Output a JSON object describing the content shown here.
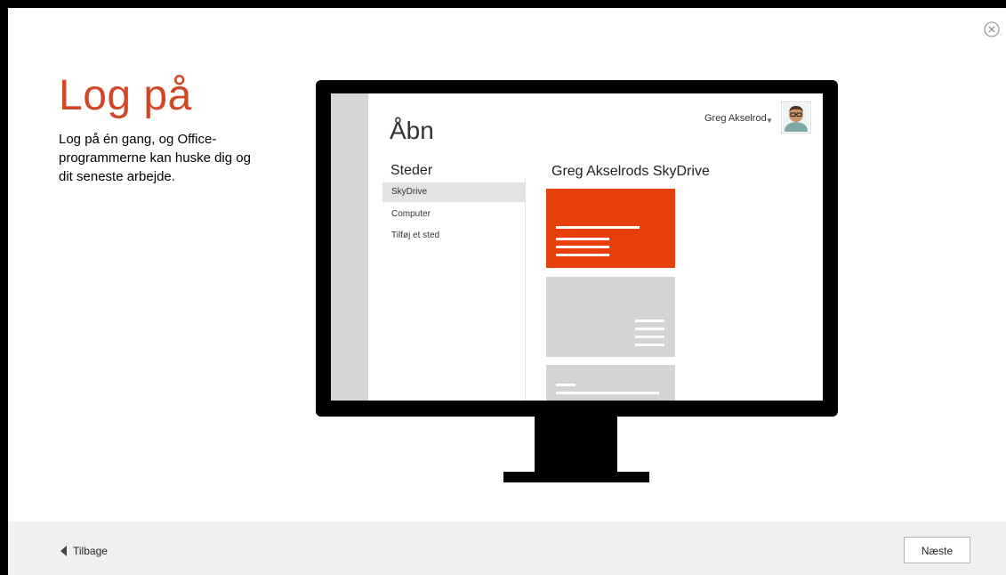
{
  "dialog": {
    "title": "Log på",
    "description": "Log på én gang, og Office-programmerne kan huske dig og dit seneste arbejde."
  },
  "illustration": {
    "open_title": "Åbn",
    "user_name": "Greg Akselrod",
    "places_title": "Steder",
    "places": [
      {
        "label": "SkyDrive",
        "selected": true
      },
      {
        "label": "Computer",
        "selected": false
      },
      {
        "label": "Tilføj et sted",
        "selected": false
      }
    ],
    "drive_title": "Greg Akselrods SkyDrive"
  },
  "footer": {
    "back_label": "Tilbage",
    "next_label": "Næste"
  },
  "colors": {
    "accent": "#d24726",
    "tile_orange": "#e8400c",
    "tile_gray": "#d4d4d4",
    "footer_bg": "#f0f0f0"
  },
  "icons": {
    "close": "close-circle-icon",
    "back": "back-arrow-icon",
    "avatar": "user-avatar"
  }
}
